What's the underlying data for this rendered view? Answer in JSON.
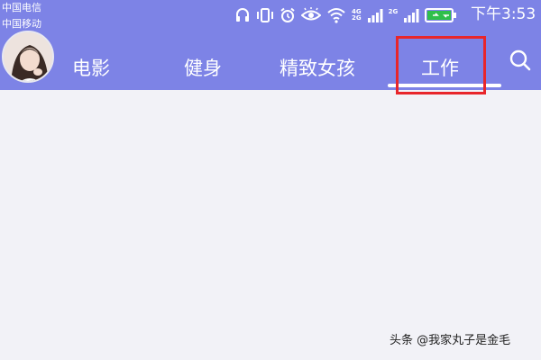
{
  "status_bar": {
    "carriers": [
      "中国电信",
      "中国移动"
    ],
    "network_1": [
      "4G",
      "2G"
    ],
    "network_2": "2G",
    "time": "下午3:53",
    "icons": [
      "headphones-icon",
      "vibrate-icon",
      "alarm-icon",
      "eye-icon",
      "wifi-icon",
      "signal-icon",
      "signal-icon",
      "battery-charging-icon"
    ]
  },
  "nav": {
    "tabs": [
      {
        "label": "电影",
        "visible_text": "电影"
      },
      {
        "label": "健身"
      },
      {
        "label": "精致女孩"
      },
      {
        "label": "工作",
        "selected": true
      }
    ],
    "search_icon": "search-icon",
    "avatar": "user-avatar"
  },
  "annotation": {
    "highlight_color": "#e8262b"
  },
  "colors": {
    "top_bar": "#7d83e6",
    "content_bg": "#f2f2f7",
    "tab_text": "#ffffff"
  },
  "watermark": "头条 @我家丸子是金毛"
}
